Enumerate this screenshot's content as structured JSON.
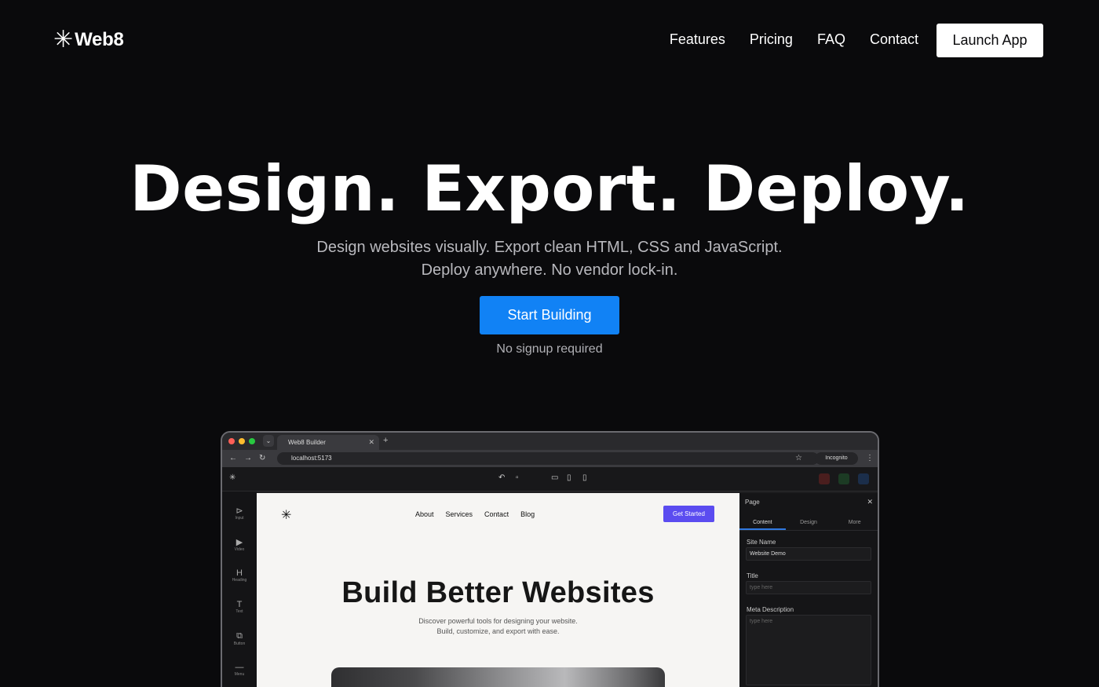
{
  "nav": {
    "logo_mark": "✳",
    "logo_text": "Web8",
    "links": [
      "Features",
      "Pricing",
      "FAQ",
      "Contact"
    ],
    "launch_label": "Launch App"
  },
  "hero": {
    "title": "Design. Export. Deploy.",
    "subtitle_line1": "Design websites visually. Export clean HTML, CSS and JavaScript.",
    "subtitle_line2": "Deploy anywhere. No vendor lock-in.",
    "cta_label": "Start Building",
    "cta_note": "No signup required"
  },
  "colors": {
    "background": "#0a0a0c",
    "cta": "#1182f5",
    "canvas_button": "#5b4cf0"
  },
  "browser": {
    "tab_title": "Web8 Builder",
    "url": "localhost:5173",
    "incognito_label": "Incognito"
  },
  "builder": {
    "sidebar": [
      {
        "icon": "frame-icon",
        "glyph": "⊳",
        "label": "Input"
      },
      {
        "icon": "video-icon",
        "glyph": "▶",
        "label": "Video"
      },
      {
        "icon": "heading-icon",
        "glyph": "H",
        "label": "Heading"
      },
      {
        "icon": "text-icon",
        "glyph": "T",
        "label": "Text"
      },
      {
        "icon": "button-icon",
        "glyph": "⧉",
        "label": "Button"
      },
      {
        "icon": "menu-icon",
        "glyph": "—",
        "label": "Menu"
      }
    ],
    "canvas": {
      "logo": "✳",
      "nav": [
        "About",
        "Services",
        "Contact",
        "Blog"
      ],
      "button": "Get Started",
      "title": "Build Better Websites",
      "subtitle_line1": "Discover powerful tools for designing your website.",
      "subtitle_line2": "Build, customize, and export with ease."
    },
    "panel": {
      "header": "Page",
      "tabs": [
        "Content",
        "Design",
        "More"
      ],
      "site_name_label": "Site Name",
      "site_name_value": "Website Demo",
      "title_label": "Title",
      "title_placeholder": "type here",
      "meta_label": "Meta Description",
      "meta_placeholder": "type here"
    }
  }
}
